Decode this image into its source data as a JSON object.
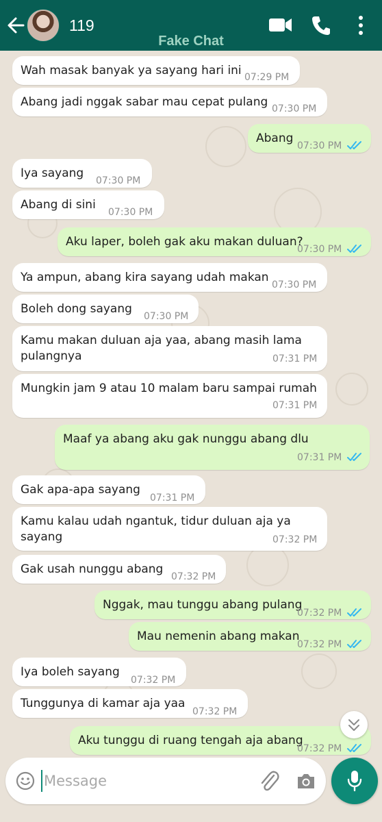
{
  "header": {
    "contact_name": "119",
    "watermark": "Fake Chat"
  },
  "icons": {
    "back": "arrow-left-icon",
    "video": "video-camera-icon",
    "call": "phone-icon",
    "menu": "more-vertical-icon",
    "emoji": "smiley-icon",
    "attach": "paperclip-icon",
    "camera": "camera-icon",
    "mic": "microphone-icon",
    "scroll": "double-chevron-down-icon"
  },
  "colors": {
    "header": "#075e54",
    "outgoing_bubble": "#dcf8c6",
    "incoming_bubble": "#ffffff",
    "read_ticks": "#34b7f1",
    "mic_button": "#0e8a77"
  },
  "messages": [
    {
      "dir": "in",
      "text": "Wah masak banyak ya sayang hari ini",
      "time": "07:29 PM"
    },
    {
      "dir": "in",
      "text": "Abang jadi nggak sabar mau cepat pulang",
      "time": "07:30 PM"
    },
    {
      "dir": "out",
      "text": "Abang",
      "time": "07:30 PM",
      "read": true
    },
    {
      "dir": "in",
      "text": "Iya sayang",
      "time": "07:30 PM"
    },
    {
      "dir": "in",
      "text": "Abang di sini",
      "time": "07:30 PM"
    },
    {
      "dir": "out",
      "text": "Aku laper, boleh gak aku makan duluan?",
      "time": "07:30 PM",
      "read": true
    },
    {
      "dir": "in",
      "text": "Ya ampun, abang kira sayang udah makan",
      "time": "07:30 PM"
    },
    {
      "dir": "in",
      "text": "Boleh dong sayang",
      "time": "07:30 PM"
    },
    {
      "dir": "in",
      "text": "Kamu makan duluan aja yaa, abang masih lama\npulangnya",
      "time": "07:31 PM"
    },
    {
      "dir": "in",
      "text": "Mungkin jam 9 atau 10 malam baru sampai rumah",
      "time": "07:31 PM"
    },
    {
      "dir": "out",
      "text": "Maaf ya abang aku gak nunggu abang dlu",
      "time": "07:31 PM",
      "read": true
    },
    {
      "dir": "in",
      "text": "Gak apa-apa sayang",
      "time": "07:31 PM"
    },
    {
      "dir": "in",
      "text": "Kamu kalau udah ngantuk, tidur duluan aja ya sayang",
      "time": "07:32 PM"
    },
    {
      "dir": "in",
      "text": "Gak usah nunggu abang",
      "time": "07:32 PM"
    },
    {
      "dir": "out",
      "text": "Nggak, mau tunggu abang pulang",
      "time": "07:32 PM",
      "read": true
    },
    {
      "dir": "out",
      "text": "Mau nemenin abang makan",
      "time": "07:32 PM",
      "read": true
    },
    {
      "dir": "in",
      "text": "Iya boleh sayang",
      "time": "07:32 PM"
    },
    {
      "dir": "in",
      "text": "Tunggunya di kamar aja yaa",
      "time": "07:32 PM"
    },
    {
      "dir": "out",
      "text": "Aku tunggu di ruang tengah aja abang",
      "time": "07:32 PM",
      "read": true
    }
  ],
  "composer": {
    "placeholder": "Message"
  }
}
